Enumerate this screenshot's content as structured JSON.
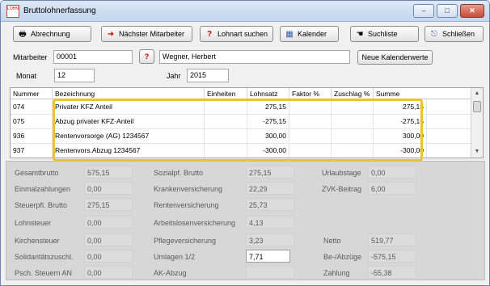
{
  "window": {
    "title": "Bruttolohnerfassung",
    "app_icon_text": "LOHN",
    "controls": {
      "minimize": "–",
      "maximize": "□",
      "close": "✕"
    }
  },
  "toolbar": [
    {
      "icon": "printer-icon",
      "glyph": "🖶",
      "label": "Abrechnung"
    },
    {
      "icon": "arrow-right-icon",
      "glyph": "➜",
      "label": "Nächster Mitarbeiter"
    },
    {
      "icon": "help-search-icon",
      "glyph": "?",
      "label": "Lohnart suchen"
    },
    {
      "icon": "calendar-icon",
      "glyph": "▦",
      "label": "Kalender"
    },
    {
      "icon": "hand-list-icon",
      "glyph": "☚",
      "label": "Suchliste"
    },
    {
      "icon": "exit-icon",
      "glyph": "⎋",
      "label": "Schließen"
    }
  ],
  "employee": {
    "label": "Mitarbeiter",
    "number": "00001",
    "name": "Wegner, Herbert",
    "lookup_glyph": "?",
    "new_calendar_button": "Neue Kalenderwerte"
  },
  "period": {
    "month_label": "Monat",
    "month_value": "12",
    "year_label": "Jahr",
    "year_value": "2015"
  },
  "table": {
    "columns": [
      "Nummer",
      "Bezeichnung",
      "Einheiten",
      "Lohnsatz",
      "Faktor %",
      "Zuschlag %",
      "Summe"
    ],
    "rows": [
      {
        "nummer": "074",
        "bezeichnung": "Privater KFZ Anteil",
        "einheiten": "",
        "lohnsatz": "275,15",
        "faktor": "",
        "zuschlag": "",
        "summe": "275,15"
      },
      {
        "nummer": "075",
        "bezeichnung": "Abzug privater KFZ-Anteil",
        "einheiten": "",
        "lohnsatz": "-275,15",
        "faktor": "",
        "zuschlag": "",
        "summe": "-275,15"
      },
      {
        "nummer": "936",
        "bezeichnung": "Rentenvorsorge (AG) 1234567",
        "einheiten": "",
        "lohnsatz": "300,00",
        "faktor": "",
        "zuschlag": "",
        "summe": "300,00"
      },
      {
        "nummer": "937",
        "bezeichnung": "Rentenvors.Abzug 1234567",
        "einheiten": "",
        "lohnsatz": "-300,00",
        "faktor": "",
        "zuschlag": "",
        "summe": "-300,00"
      }
    ]
  },
  "summary": {
    "col1": [
      {
        "label": "Gesamtbrutto",
        "value": "575,15"
      },
      {
        "label": "Einmalzahlungen",
        "value": "0,00"
      },
      {
        "label": "Steuerpfl. Brutto",
        "value": "275,15"
      },
      {
        "label": "Lohnsteuer",
        "value": "0,00"
      },
      {
        "label": "Kirchensteuer",
        "value": "0,00"
      },
      {
        "label": "Solidaritätszuschl.",
        "value": "0,00"
      },
      {
        "label": "Psch. Steuern AN",
        "value": "0,00"
      }
    ],
    "col2": [
      {
        "label": "Sozialpf. Brutto",
        "value": "275,15"
      },
      {
        "label": "Krankenversicherung",
        "value": "22,29"
      },
      {
        "label": "Rentenversicherung",
        "value": "25,73"
      },
      {
        "label": "Arbeitslosenversicherung",
        "value": "4,13"
      },
      {
        "label": "Pflegeversicherung",
        "value": "3,23"
      },
      {
        "label": "Umlagen 1/2",
        "value": "7,71"
      },
      {
        "label": "AK-Abzug",
        "value": ""
      }
    ],
    "col3": [
      {
        "label": "Urlaubstage",
        "value": "0,00"
      },
      {
        "label": "ZVK-Beitrag",
        "value": "6,00"
      }
    ],
    "totals": [
      {
        "label": "Netto",
        "value": "519,77"
      },
      {
        "label": "Be-/Abzüge",
        "value": "-575,15"
      },
      {
        "label": "Zahlung",
        "value": "-55,38"
      }
    ]
  },
  "colors": {
    "highlight": "#f2c12e",
    "title_gradient_top": "#dce8f6",
    "summary_bg": "#d7d7d7"
  }
}
